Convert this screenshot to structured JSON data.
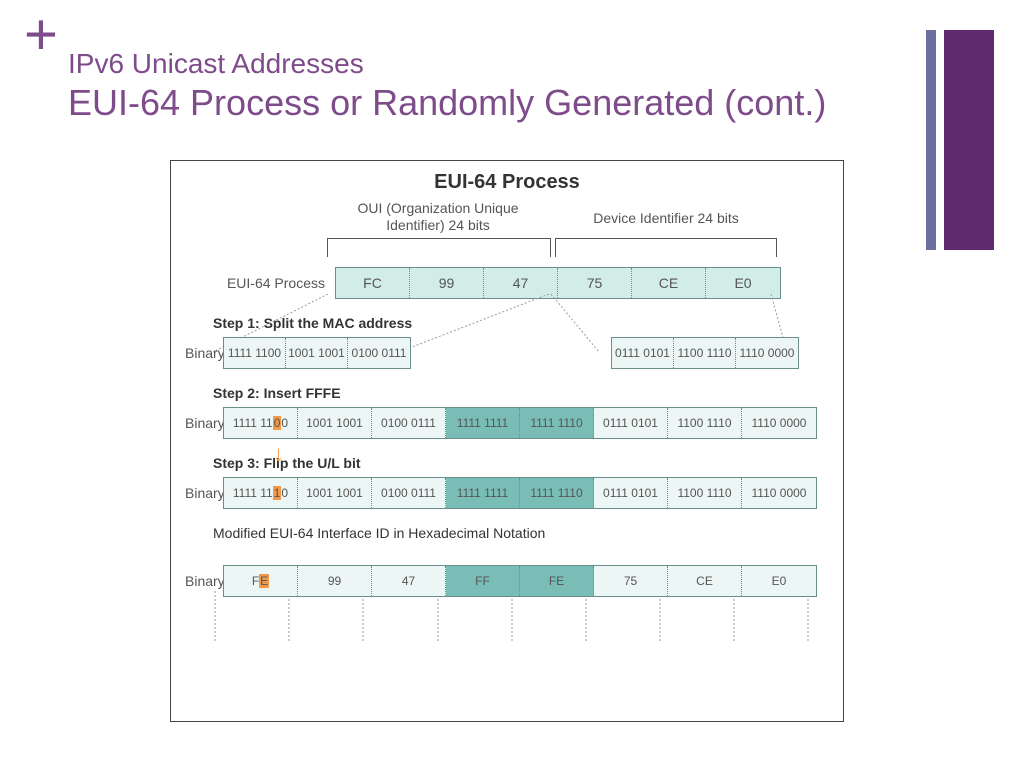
{
  "header": {
    "plus": "+",
    "sub": "IPv6 Unicast Addresses",
    "title": "EUI-64 Process or Randomly Generated (cont.)"
  },
  "diagram": {
    "title": "EUI-64 Process",
    "oui_label": "OUI (Organization Unique Identifier) 24 bits",
    "dev_label": "Device Identifier 24 bits",
    "row1_label": "EUI-64 Process",
    "mac": [
      "FC",
      "99",
      "47",
      "75",
      "CE",
      "E0"
    ],
    "step1": "Step 1: Split the MAC address",
    "row2_label": "Binary",
    "bin_left": [
      "1111 1100",
      "1001 1001",
      "0100 0111"
    ],
    "bin_right": [
      "0111 0101",
      "1100 1110",
      "1110 0000"
    ],
    "step2": "Step 2: Insert FFFE",
    "row3_label": "Binary",
    "bin2": [
      "1111 1100",
      "1001 1001",
      "0100 0111",
      "1111 1111",
      "1111 1110",
      "0111 0101",
      "1100 1110",
      "1110 0000"
    ],
    "step3": "Step 3: Flip the U/L bit",
    "row4_label": "Binary",
    "bin3": [
      "1111 1110",
      "1001 1001",
      "0100 0111",
      "1111 1111",
      "1111 1110",
      "0111 0101",
      "1100 1110",
      "1110 0000"
    ],
    "final_label": "Modified EUI-64 Interface ID in Hexadecimal Notation",
    "row5_label": "Binary",
    "hex": [
      "FE",
      "99",
      "47",
      "FF",
      "FE",
      "75",
      "CE",
      "E0"
    ]
  }
}
